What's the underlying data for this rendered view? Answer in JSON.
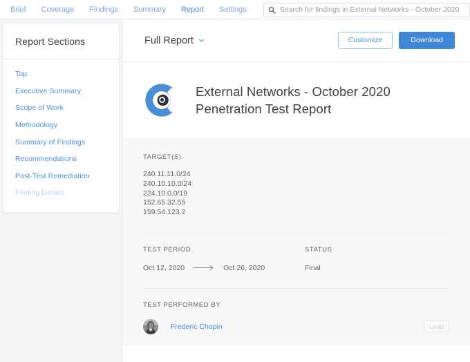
{
  "nav": {
    "tabs": [
      {
        "label": "Brief",
        "active": false
      },
      {
        "label": "Coverage",
        "active": false
      },
      {
        "label": "Findings",
        "active": false
      },
      {
        "label": "Summary",
        "active": false
      },
      {
        "label": "Report",
        "active": true
      },
      {
        "label": "Settings",
        "active": false
      }
    ]
  },
  "search": {
    "icon": "search-icon",
    "placeholder": "Search for findings in External Networks - October 2020",
    "value": ""
  },
  "sidebar": {
    "title": "Report Sections",
    "items": [
      {
        "label": "Top",
        "disabled": false
      },
      {
        "label": "Executive Summary",
        "disabled": false
      },
      {
        "label": "Scope of Work",
        "disabled": false
      },
      {
        "label": "Methodology",
        "disabled": false
      },
      {
        "label": "Summary of Findings",
        "disabled": false
      },
      {
        "label": "Recommendations",
        "disabled": false
      },
      {
        "label": "Post-Test Remediation",
        "disabled": false
      },
      {
        "label": "Finding Details",
        "disabled": true
      }
    ]
  },
  "toolbar": {
    "report_selector_label": "Full Report",
    "chevron_icon": "chevron-down-icon",
    "customize_label": "Customize",
    "download_label": "Download"
  },
  "report": {
    "logo_icon": "gear-c-logo-icon",
    "title_line1": "External Networks - October 2020",
    "title_line2": "Penetration Test Report",
    "targets_label": "TARGET(S)",
    "targets": [
      "240.11.11.0/24",
      "240.10.10.0/24",
      "224.10.0.0/19",
      "152.65.32.55",
      "159.54.123.2"
    ],
    "test_period_label": "TEST PERIOD",
    "test_period_start": "Oct 12, 2020",
    "test_period_arrow_icon": "arrow-right-icon",
    "test_period_end": "Oct 26, 2020",
    "status_label": "STATUS",
    "status_value": "Final",
    "performed_by_label": "TEST PERFORMED BY",
    "performer_name": "Frederic Chopin",
    "performer_badge": "Lead"
  },
  "colors": {
    "accent_blue": "#3f87d8",
    "link_blue": "#4a8fe0",
    "page_bg": "#f4f5f6",
    "meta_bg": "#f7f7f8",
    "text": "#3c4043",
    "muted_text": "#5f6368"
  }
}
